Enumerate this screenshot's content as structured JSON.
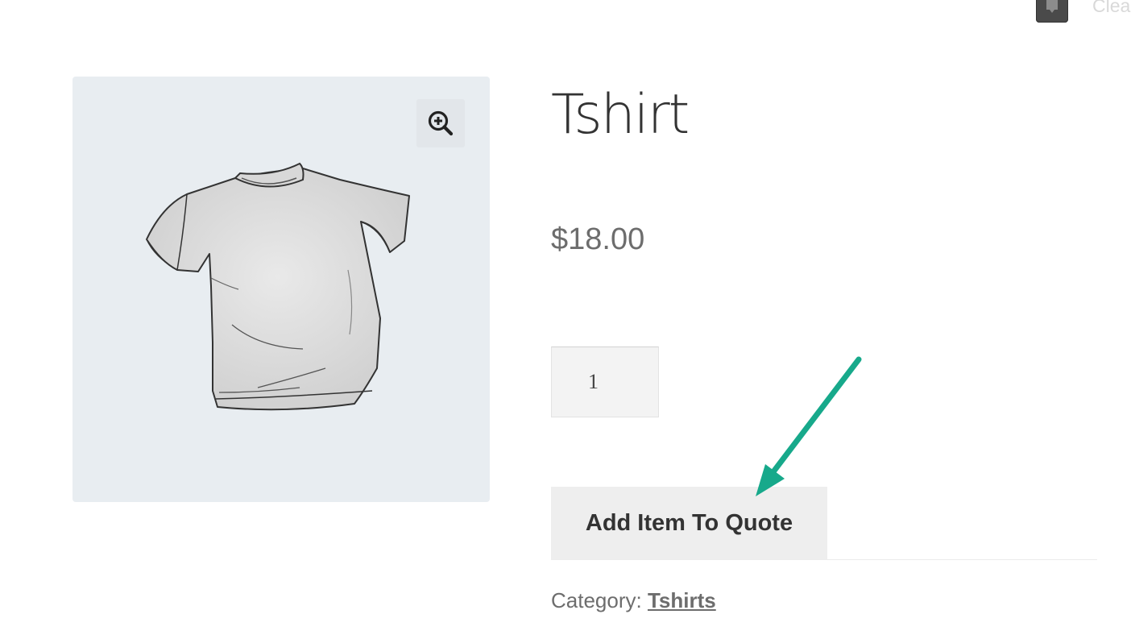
{
  "header": {
    "partial_link_text": "Clea",
    "widget_icon": "speech-bubble-icon"
  },
  "gallery": {
    "zoom_icon": "zoom-in-icon",
    "image_icon": "tshirt-image"
  },
  "product": {
    "title": "Tshirt",
    "price": "$18.00",
    "quantity": "1",
    "add_to_quote_label": "Add Item To Quote",
    "category_label": "Category:",
    "category_link": "Tshirts"
  },
  "annotation": {
    "arrow_color": "#17a98b"
  },
  "colors": {
    "gallery_bg": "#e8edf1",
    "button_bg": "#eeeeee",
    "text_dark": "#333333",
    "text_muted": "#6d6d6d"
  }
}
